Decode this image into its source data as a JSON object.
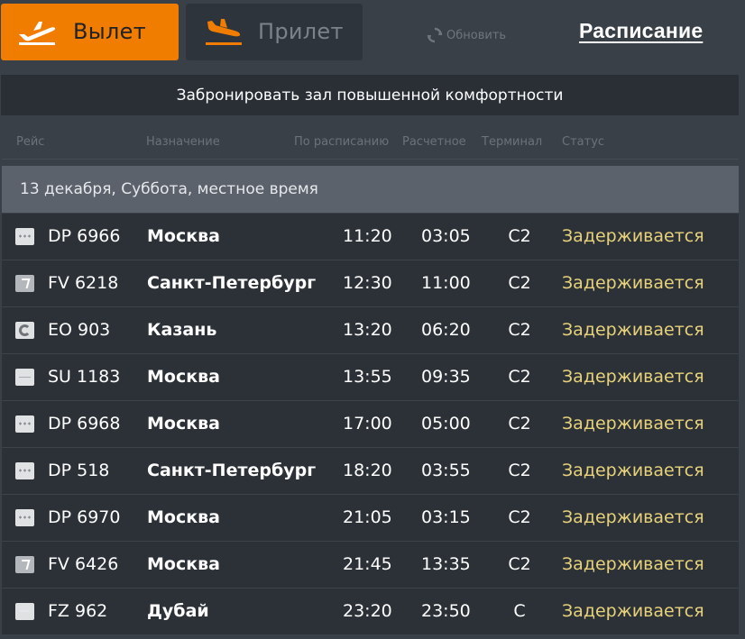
{
  "tabs": {
    "departure_label": "Вылет",
    "arrival_label": "Прилет",
    "departure_icon": "plane-takeoff-icon",
    "arrival_icon": "plane-landing-icon",
    "accent_color": "#f07d00"
  },
  "refresh_label": "Обновить",
  "schedule_link": "Расписание",
  "banner": "Забронировать зал повышенной комфортности",
  "columns": {
    "flight": "Рейс",
    "destination": "Назначение",
    "scheduled": "По расписанию",
    "estimated": "Расчетное",
    "terminal": "Терминал",
    "status": "Статус"
  },
  "date_group": "13 декабря, Суббота, местное время",
  "status_color": "#e7d27a",
  "flights": [
    {
      "logo": "dp",
      "flight": "DP 6966",
      "destination": "Москва",
      "scheduled": "11:20",
      "estimated": "03:05",
      "terminal": "C2",
      "status": "Задерживается"
    },
    {
      "logo": "fv",
      "flight": "FV 6218",
      "destination": "Санкт-Петербург",
      "scheduled": "12:30",
      "estimated": "11:00",
      "terminal": "C2",
      "status": "Задерживается"
    },
    {
      "logo": "eo",
      "flight": "EO 903",
      "destination": "Казань",
      "scheduled": "13:20",
      "estimated": "06:20",
      "terminal": "C2",
      "status": "Задерживается"
    },
    {
      "logo": "su",
      "flight": "SU 1183",
      "destination": "Москва",
      "scheduled": "13:55",
      "estimated": "09:35",
      "terminal": "C2",
      "status": "Задерживается"
    },
    {
      "logo": "dp",
      "flight": "DP 6968",
      "destination": "Москва",
      "scheduled": "17:00",
      "estimated": "05:00",
      "terminal": "C2",
      "status": "Задерживается"
    },
    {
      "logo": "dp",
      "flight": "DP 518",
      "destination": "Санкт-Петербург",
      "scheduled": "18:20",
      "estimated": "03:55",
      "terminal": "C2",
      "status": "Задерживается"
    },
    {
      "logo": "dp",
      "flight": "DP 6970",
      "destination": "Москва",
      "scheduled": "21:05",
      "estimated": "03:15",
      "terminal": "C2",
      "status": "Задерживается"
    },
    {
      "logo": "fv",
      "flight": "FV 6426",
      "destination": "Москва",
      "scheduled": "21:45",
      "estimated": "13:35",
      "terminal": "C2",
      "status": "Задерживается"
    },
    {
      "logo": "fz",
      "flight": "FZ 962",
      "destination": "Дубай",
      "scheduled": "23:20",
      "estimated": "23:50",
      "terminal": "C",
      "status": "Задерживается"
    }
  ]
}
